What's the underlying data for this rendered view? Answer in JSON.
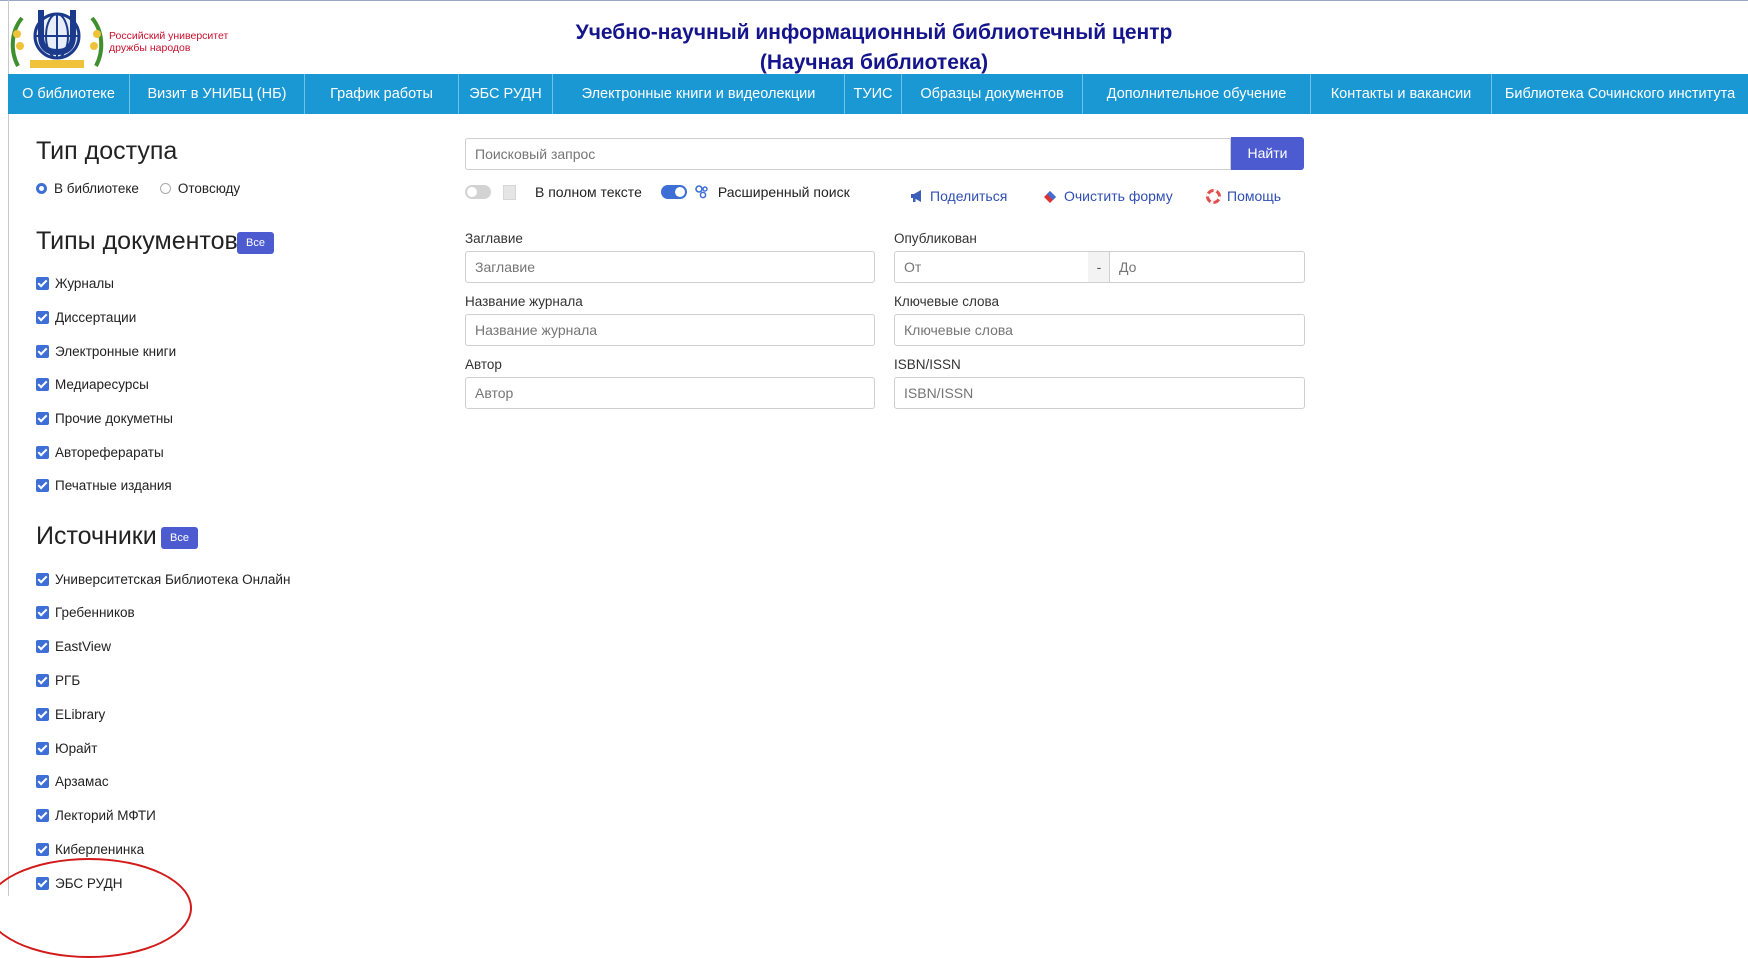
{
  "header": {
    "univ_name_line1": "Российский университет",
    "univ_name_line2": "дружбы народов",
    "title_line1": "Учебно-научный информационный библиотечный центр",
    "title_line2": "(Научная библиотека)"
  },
  "nav": [
    "О библиотеке",
    "Визит в УНИБЦ (НБ)",
    "График работы",
    "ЭБС РУДН",
    "Электронные книги и видеолекции",
    "ТУИС",
    "Образцы документов",
    "Дополнительное обучение",
    "Контакты и вакансии",
    "Библиотека Сочинского института"
  ],
  "access": {
    "heading": "Тип доступа",
    "option_library": "В библиотеке",
    "option_anywhere": "Отовсюду",
    "selected": "В библиотеке"
  },
  "doc_types": {
    "heading": "Типы документов",
    "all_label": "Все",
    "items": [
      "Журналы",
      "Диссертации",
      "Электронные книги",
      "Медиаресурсы",
      "Прочие докуметны",
      "Автореферараты",
      "Печатные издания"
    ]
  },
  "sources": {
    "heading": "Источники",
    "all_label": "Все",
    "items": [
      "Университетская Библиотека Онлайн",
      "Гребенников",
      "EastView",
      "РГБ",
      "ELibrary",
      "Юрайт",
      "Арзамас",
      "Лекторий МФТИ",
      "Киберленинка",
      "ЭБС РУДН"
    ]
  },
  "search": {
    "placeholder": "Поисковый запрос",
    "button": "Найти",
    "fulltext_label": "В полном тексте",
    "advanced_label": "Расширенный поиск",
    "share": "Поделиться",
    "clear": "Очистить форму",
    "help": "Помощь"
  },
  "fields": {
    "title_label": "Заглавие",
    "title_placeholder": "Заглавие",
    "journal_label": "Название журнала",
    "journal_placeholder": "Название журнала",
    "author_label": "Автор",
    "author_placeholder": "Автор",
    "published_label": "Опубликован",
    "from_placeholder": "От",
    "dash": "-",
    "to_placeholder": "До",
    "keywords_label": "Ключевые слова",
    "keywords_placeholder": "Ключевые слова",
    "isbn_label": "ISBN/ISSN",
    "isbn_placeholder": "ISBN/ISSN"
  },
  "colors": {
    "nav_bg": "#1a98d3",
    "accent": "#4c5bd0",
    "title": "#14148c",
    "annotation": "#d21a1a"
  }
}
